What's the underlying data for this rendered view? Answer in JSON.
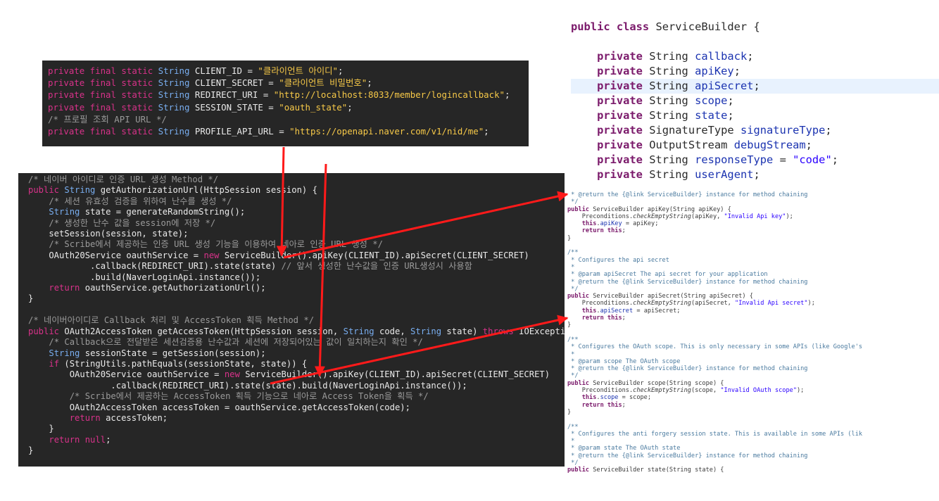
{
  "constants_code": [
    [
      [
        "kw",
        "private final static "
      ],
      [
        "ty",
        "String "
      ],
      [
        "pl",
        "CLIENT_ID = "
      ],
      [
        "st",
        "\"클라이언트 아이디\""
      ],
      [
        "pl",
        ";"
      ]
    ],
    [
      [
        "kw",
        "private final static "
      ],
      [
        "ty",
        "String "
      ],
      [
        "pl",
        "CLIENT_SECRET = "
      ],
      [
        "st",
        "\"클라이언트 비밀번호\""
      ],
      [
        "pl",
        ";"
      ]
    ],
    [
      [
        "kw",
        "private final static "
      ],
      [
        "ty",
        "String "
      ],
      [
        "pl",
        "REDIRECT_URI = "
      ],
      [
        "st",
        "\"http://localhost:8033/member/logincallback\""
      ],
      [
        "pl",
        ";"
      ]
    ],
    [
      [
        "kw",
        "private final static "
      ],
      [
        "ty",
        "String "
      ],
      [
        "pl",
        "SESSION_STATE = "
      ],
      [
        "st",
        "\"oauth_state\""
      ],
      [
        "pl",
        ";"
      ]
    ],
    [
      [
        "cm",
        "/* 프로필 조회 API URL */"
      ]
    ],
    [
      [
        "kw",
        "private final static "
      ],
      [
        "ty",
        "String "
      ],
      [
        "pl",
        "PROFILE_API_URL = "
      ],
      [
        "st",
        "\"https://openapi.naver.com/v1/nid/me\""
      ],
      [
        "pl",
        ";"
      ]
    ]
  ],
  "auth_code": [
    [
      [
        "cm",
        "/* 네이버 아이디로 인증 URL 생성 Method */"
      ]
    ],
    [
      [
        "kw",
        "public "
      ],
      [
        "ty",
        "String "
      ],
      [
        "pl",
        "getAuthorizationUrl(HttpSession session) {"
      ]
    ],
    [
      [
        "pl",
        "    "
      ],
      [
        "cm",
        "/* 세션 유효성 검증을 위하여 난수를 생성 */"
      ]
    ],
    [
      [
        "pl",
        "    "
      ],
      [
        "ty",
        "String "
      ],
      [
        "pl",
        "state = generateRandomString();"
      ]
    ],
    [
      [
        "pl",
        "    "
      ],
      [
        "cm",
        "/* 생성한 난수 값을 session에 저장 */"
      ]
    ],
    [
      [
        "pl",
        "    setSession(session, state);"
      ]
    ],
    [
      [
        "pl",
        "    "
      ],
      [
        "cm",
        "/* Scribe에서 제공하는 인증 URL 생성 기능을 이용하여 네아로 인증 URL 생성 */"
      ]
    ],
    [
      [
        "pl",
        "    OAuth20Service oauthService = "
      ],
      [
        "kw",
        "new "
      ],
      [
        "pl",
        "ServiceBuilder().apiKey(CLIENT_ID).apiSecret(CLIENT_SECRET)"
      ]
    ],
    [
      [
        "pl",
        "            .callback(REDIRECT_URI).state(state) "
      ],
      [
        "cm",
        "// 앞서 생성한 난수값을 인증 URL생성시 사용함"
      ]
    ],
    [
      [
        "pl",
        "            .build(NaverLoginApi.instance());"
      ]
    ],
    [
      [
        "pl",
        "    "
      ],
      [
        "kw",
        "return "
      ],
      [
        "pl",
        "oauthService.getAuthorizationUrl();"
      ]
    ],
    [
      [
        "pl",
        "}"
      ]
    ],
    [
      [
        "pl",
        ""
      ]
    ],
    [
      [
        "cm",
        "/* 네이버아이디로 Callback 처리 및 AccessToken 획득 Method */"
      ]
    ],
    [
      [
        "kw",
        "public "
      ],
      [
        "pl",
        "OAuth2AccessToken getAccessToken(HttpSession session, "
      ],
      [
        "ty",
        "String "
      ],
      [
        "pl",
        "code, "
      ],
      [
        "ty",
        "String "
      ],
      [
        "pl",
        "state) "
      ],
      [
        "kw",
        "throws "
      ],
      [
        "pl",
        "IOException{"
      ]
    ],
    [
      [
        "pl",
        "    "
      ],
      [
        "cm",
        "/* Callback으로 전달받은 세션검증용 난수값과 세션에 저장되어있는 값이 일치하는지 확인 */"
      ]
    ],
    [
      [
        "pl",
        "    "
      ],
      [
        "ty",
        "String "
      ],
      [
        "pl",
        "sessionState = getSession(session);"
      ]
    ],
    [
      [
        "pl",
        "    "
      ],
      [
        "kw",
        "if "
      ],
      [
        "pl",
        "(StringUtils.pathEquals(sessionState, state)) {"
      ]
    ],
    [
      [
        "pl",
        "        OAuth20Service oauthService = "
      ],
      [
        "kw",
        "new "
      ],
      [
        "pl",
        "ServiceBuilder().apiKey(CLIENT_ID).apiSecret(CLIENT_SECRET)"
      ]
    ],
    [
      [
        "pl",
        "                .callback(REDIRECT_URI).state(state).build(NaverLoginApi.instance());"
      ]
    ],
    [
      [
        "pl",
        "        "
      ],
      [
        "cm",
        "/* Scribe에서 제공하는 AccessToken 획득 기능으로 네아로 Access Token을 획득 */"
      ]
    ],
    [
      [
        "pl",
        "        OAuth2AccessToken accessToken = oauthService.getAccessToken(code);"
      ]
    ],
    [
      [
        "pl",
        "        "
      ],
      [
        "kw",
        "return "
      ],
      [
        "pl",
        "accessToken;"
      ]
    ],
    [
      [
        "pl",
        "    }"
      ]
    ],
    [
      [
        "pl",
        "    "
      ],
      [
        "kw",
        "return null"
      ],
      [
        "pl",
        ";"
      ]
    ],
    [
      [
        "pl",
        "}"
      ]
    ]
  ],
  "class_code": [
    [
      [
        "nk",
        "public class "
      ],
      [
        "nt",
        "ServiceBuilder {"
      ]
    ],
    [
      [
        "nt",
        ""
      ]
    ],
    [
      [
        "nt",
        "    "
      ],
      [
        "nk",
        "private "
      ],
      [
        "nt",
        "String "
      ],
      [
        "nf",
        "callback"
      ],
      [
        "nt",
        ";"
      ]
    ],
    [
      [
        "nt",
        "    "
      ],
      [
        "nk",
        "private "
      ],
      [
        "nt",
        "String "
      ],
      [
        "nf",
        "apiKey"
      ],
      [
        "nt",
        ";"
      ]
    ],
    [
      [
        "nt",
        "    "
      ],
      [
        "nk",
        "private "
      ],
      [
        "nt",
        "String "
      ],
      [
        "nf",
        "apiSecret"
      ],
      [
        "nt",
        ";"
      ]
    ],
    [
      [
        "nt",
        "    "
      ],
      [
        "nk",
        "private "
      ],
      [
        "nt",
        "String "
      ],
      [
        "nf",
        "scope"
      ],
      [
        "nt",
        ";"
      ]
    ],
    [
      [
        "nt",
        "    "
      ],
      [
        "nk",
        "private "
      ],
      [
        "nt",
        "String "
      ],
      [
        "nf",
        "state"
      ],
      [
        "nt",
        ";"
      ]
    ],
    [
      [
        "nt",
        "    "
      ],
      [
        "nk",
        "private "
      ],
      [
        "nt",
        "SignatureType "
      ],
      [
        "nf",
        "signatureType"
      ],
      [
        "nt",
        ";"
      ]
    ],
    [
      [
        "nt",
        "    "
      ],
      [
        "nk",
        "private "
      ],
      [
        "nt",
        "OutputStream "
      ],
      [
        "nf",
        "debugStream"
      ],
      [
        "nt",
        ";"
      ]
    ],
    [
      [
        "nt",
        "    "
      ],
      [
        "nk",
        "private "
      ],
      [
        "nt",
        "String "
      ],
      [
        "nf",
        "responseType"
      ],
      [
        "nt",
        " = "
      ],
      [
        "ns",
        "\"code\""
      ],
      [
        "nt",
        ";"
      ]
    ],
    [
      [
        "nt",
        "    "
      ],
      [
        "nk",
        "private "
      ],
      [
        "nt",
        "String "
      ],
      [
        "nf",
        "userAgent"
      ],
      [
        "nt",
        ";"
      ]
    ]
  ],
  "class_highlight_line": 4,
  "methods_code": [
    [
      [
        "nc",
        " * @return the {@link ServiceBuilder} instance for method chaining"
      ]
    ],
    [
      [
        "nc",
        " */"
      ]
    ],
    [
      [
        "nk",
        "public "
      ],
      [
        "nm",
        "ServiceBuilder apiKey(String apiKey) {"
      ]
    ],
    [
      [
        "nm",
        "    Preconditions."
      ],
      [
        "nm it",
        "checkEmptyString"
      ],
      [
        "nm",
        "(apiKey, "
      ],
      [
        "ns",
        "\"Invalid Api key\""
      ],
      [
        "nm",
        ");"
      ]
    ],
    [
      [
        "nm",
        "    "
      ],
      [
        "nk",
        "this"
      ],
      [
        "nm",
        "."
      ],
      [
        "nf",
        "apiKey"
      ],
      [
        "nm",
        " = apiKey;"
      ]
    ],
    [
      [
        "nm",
        "    "
      ],
      [
        "nk",
        "return this"
      ],
      [
        "nm",
        ";"
      ]
    ],
    [
      [
        "nm",
        "}"
      ]
    ],
    [
      [
        "nm",
        ""
      ]
    ],
    [
      [
        "nc",
        "/**"
      ]
    ],
    [
      [
        "nc",
        " * Configures the api secret"
      ]
    ],
    [
      [
        "nc",
        " *"
      ]
    ],
    [
      [
        "nc",
        " * @param apiSecret The api secret for your application"
      ]
    ],
    [
      [
        "nc",
        " * @return the {@link ServiceBuilder} instance for method chaining"
      ]
    ],
    [
      [
        "nc",
        " */"
      ]
    ],
    [
      [
        "nk",
        "public "
      ],
      [
        "nm",
        "ServiceBuilder apiSecret(String apiSecret) {"
      ]
    ],
    [
      [
        "nm",
        "    Preconditions."
      ],
      [
        "nm it",
        "checkEmptyString"
      ],
      [
        "nm",
        "(apiSecret, "
      ],
      [
        "ns",
        "\"Invalid Api secret\""
      ],
      [
        "nm",
        ");"
      ]
    ],
    [
      [
        "nm",
        "    "
      ],
      [
        "nk",
        "this"
      ],
      [
        "nm",
        "."
      ],
      [
        "nf",
        "apiSecret"
      ],
      [
        "nm",
        " = apiSecret;"
      ]
    ],
    [
      [
        "nm",
        "    "
      ],
      [
        "nk",
        "return this"
      ],
      [
        "nm",
        ";"
      ]
    ],
    [
      [
        "nm",
        "}"
      ]
    ],
    [
      [
        "nm",
        ""
      ]
    ],
    [
      [
        "nc",
        "/**"
      ]
    ],
    [
      [
        "nc",
        " * Configures the OAuth scope. This is only necessary in some APIs (like Google's"
      ]
    ],
    [
      [
        "nc",
        " *"
      ]
    ],
    [
      [
        "nc",
        " * @param scope The OAuth scope"
      ]
    ],
    [
      [
        "nc",
        " * @return the {@link ServiceBuilder} instance for method chaining"
      ]
    ],
    [
      [
        "nc",
        " */"
      ]
    ],
    [
      [
        "nk",
        "public "
      ],
      [
        "nm",
        "ServiceBuilder scope(String scope) {"
      ]
    ],
    [
      [
        "nm",
        "    Preconditions."
      ],
      [
        "nm it",
        "checkEmptyString"
      ],
      [
        "nm",
        "(scope, "
      ],
      [
        "ns",
        "\"Invalid OAuth scope\""
      ],
      [
        "nm",
        ");"
      ]
    ],
    [
      [
        "nm",
        "    "
      ],
      [
        "nk",
        "this"
      ],
      [
        "nm",
        "."
      ],
      [
        "nf",
        "scope"
      ],
      [
        "nm",
        " = scope;"
      ]
    ],
    [
      [
        "nm",
        "    "
      ],
      [
        "nk",
        "return this"
      ],
      [
        "nm",
        ";"
      ]
    ],
    [
      [
        "nm",
        "}"
      ]
    ],
    [
      [
        "nm",
        ""
      ]
    ],
    [
      [
        "nc",
        "/**"
      ]
    ],
    [
      [
        "nc",
        " * Configures the anti forgery session state. This is available in some APIs (lik"
      ]
    ],
    [
      [
        "nc",
        " *"
      ]
    ],
    [
      [
        "nc",
        " * @param state The OAuth state"
      ]
    ],
    [
      [
        "nc",
        " * @return the {@link ServiceBuilder} instance for method chaining"
      ]
    ],
    [
      [
        "nc",
        " */"
      ]
    ],
    [
      [
        "nk",
        "public "
      ],
      [
        "nm",
        "ServiceBuilder state(String state) {"
      ]
    ]
  ],
  "colors": {
    "dark_background": "#262626",
    "annotation_arrow": "#ff1a1a",
    "keyword": "#d8328a",
    "string": "#f7c948",
    "type": "#79aef0"
  }
}
